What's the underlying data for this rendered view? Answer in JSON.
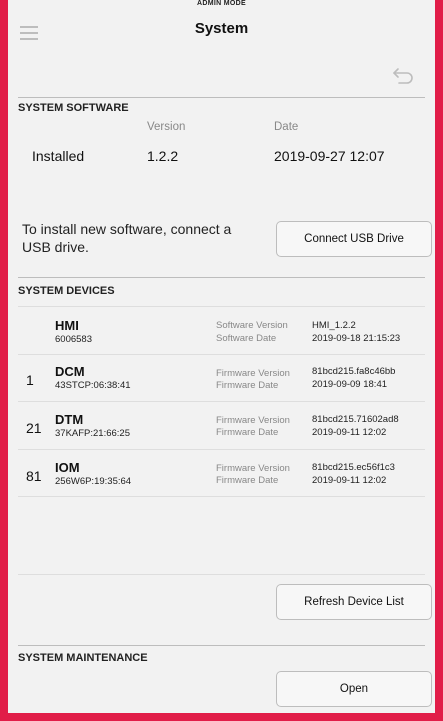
{
  "mode_label": "ADMIN MODE",
  "header": {
    "title": "System"
  },
  "system_software": {
    "title": "SYSTEM SOFTWARE",
    "col_version": "Version",
    "col_date": "Date",
    "row_label": "Installed",
    "version": "1.2.2",
    "date": "2019-09-27 12:07"
  },
  "usb": {
    "message": "To install new software, connect a USB drive.",
    "button": "Connect USB Drive"
  },
  "system_devices": {
    "title": "SYSTEM DEVICES",
    "devices": [
      {
        "number": "",
        "name": "HMI",
        "id": "6006583",
        "label1": "Software Version",
        "label2": "Software Date",
        "value1": "HMI_1.2.2",
        "value2": "2019-09-18 21:15:23"
      },
      {
        "number": "1",
        "name": "DCM",
        "id": "43STCP:06:38:41",
        "label1": "Firmware Version",
        "label2": "Firmware Date",
        "value1": "81bcd215.fa8c46bb",
        "value2": "2019-09-09 18:41"
      },
      {
        "number": "21",
        "name": "DTM",
        "id": "37KAFP:21:66:25",
        "label1": "Firmware Version",
        "label2": "Firmware Date",
        "value1": "81bcd215.71602ad8",
        "value2": "2019-09-11 12:02"
      },
      {
        "number": "81",
        "name": "IOM",
        "id": "256W6P:19:35:64",
        "label1": "Firmware Version",
        "label2": "Firmware Date",
        "value1": "81bcd215.ec56f1c3",
        "value2": "2019-09-11 12:02"
      }
    ],
    "refresh_button": "Refresh Device List"
  },
  "system_maintenance": {
    "title": "SYSTEM MAINTENANCE",
    "open_button": "Open"
  }
}
